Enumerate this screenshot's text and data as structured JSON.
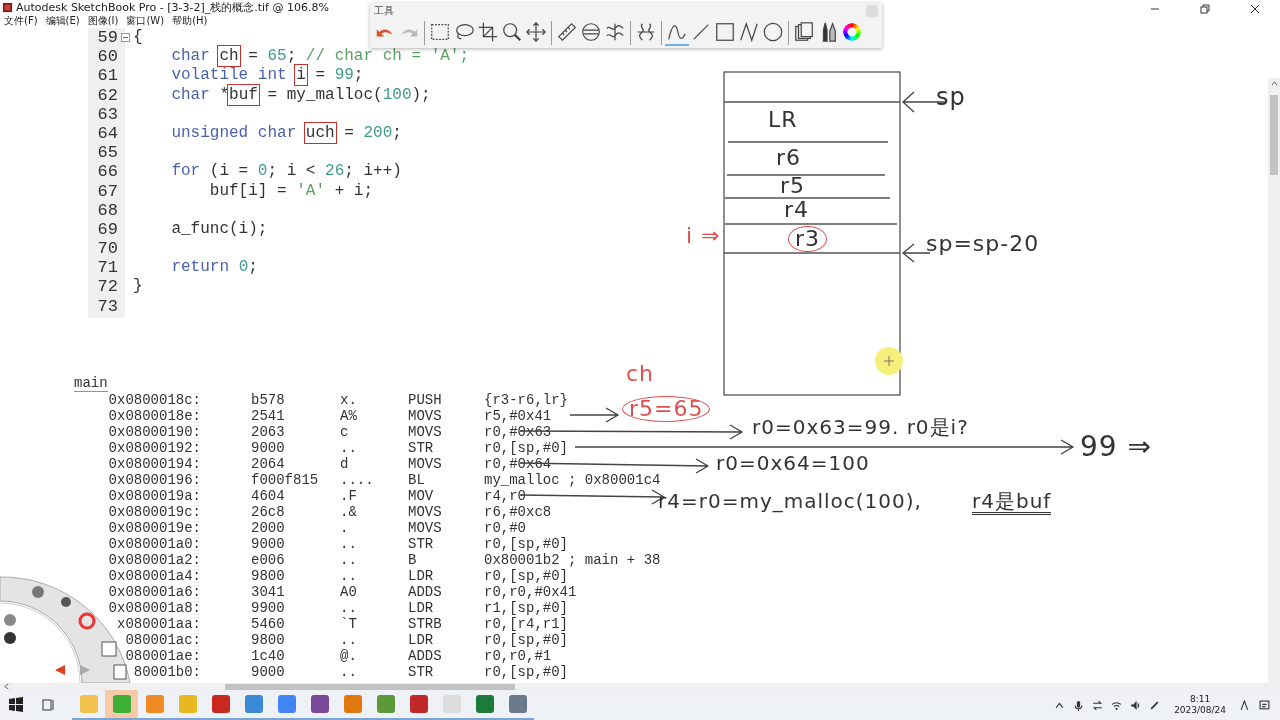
{
  "window": {
    "title": "Autodesk SketchBook Pro - [3-3-2]_栈的概念.tif @ 106.8%",
    "menu": [
      "文件(F)",
      "编辑(E)",
      "图像(I)",
      "窗口(W)",
      "帮助(H)"
    ]
  },
  "toolbar": {
    "title": "工具",
    "groups": [
      [
        {
          "kind": "undo",
          "selected": false
        },
        {
          "kind": "redo",
          "selected": false
        }
      ],
      [
        {
          "kind": "select",
          "selected": false
        },
        {
          "kind": "lasso",
          "selected": false
        },
        {
          "kind": "crop",
          "selected": false
        },
        {
          "kind": "zoom",
          "selected": false
        },
        {
          "kind": "move",
          "selected": false
        }
      ],
      [
        {
          "kind": "ruler",
          "selected": false
        },
        {
          "kind": "ellipse",
          "selected": false
        },
        {
          "kind": "symmetry",
          "selected": false
        }
      ],
      [
        {
          "kind": "symmetry2",
          "selected": false
        }
      ],
      [
        {
          "kind": "stroke",
          "selected": true
        },
        {
          "kind": "line",
          "selected": false
        },
        {
          "kind": "rect",
          "selected": false
        },
        {
          "kind": "polyline",
          "selected": false
        },
        {
          "kind": "circle",
          "selected": false
        }
      ],
      [
        {
          "kind": "layers",
          "selected": false
        },
        {
          "kind": "brushes",
          "selected": false
        },
        {
          "kind": "color",
          "selected": false
        }
      ]
    ]
  },
  "code": {
    "lines": [
      {
        "number": "59",
        "fold": true,
        "tokens": [
          {
            "text": "{",
            "kind": "plain"
          }
        ]
      },
      {
        "number": "60",
        "fold": false,
        "tokens": [
          {
            "text": "    char ",
            "kind": "kw"
          },
          {
            "text": "ch",
            "kind": "boxed"
          },
          {
            "text": " = ",
            "kind": "plain"
          },
          {
            "text": "65",
            "kind": "num"
          },
          {
            "text": "; ",
            "kind": "plain"
          },
          {
            "text": "// char ch = 'A';",
            "kind": "cmt"
          }
        ]
      },
      {
        "number": "61",
        "fold": false,
        "tokens": [
          {
            "text": "    volatile int ",
            "kind": "kw"
          },
          {
            "text": "i",
            "kind": "boxed"
          },
          {
            "text": " = ",
            "kind": "plain"
          },
          {
            "text": "99",
            "kind": "num"
          },
          {
            "text": ";",
            "kind": "plain"
          }
        ]
      },
      {
        "number": "62",
        "fold": false,
        "tokens": [
          {
            "text": "    char ",
            "kind": "kw"
          },
          {
            "text": "*",
            "kind": "plain"
          },
          {
            "text": "buf",
            "kind": "boxed"
          },
          {
            "text": " = my_malloc(",
            "kind": "plain"
          },
          {
            "text": "100",
            "kind": "num"
          },
          {
            "text": ");",
            "kind": "plain"
          }
        ]
      },
      {
        "number": "63",
        "fold": false
      },
      {
        "number": "64",
        "fold": false,
        "tokens": [
          {
            "text": "    unsigned char ",
            "kind": "kw"
          },
          {
            "text": "uch",
            "kind": "boxed"
          },
          {
            "text": " = ",
            "kind": "plain"
          },
          {
            "text": "200",
            "kind": "num"
          },
          {
            "text": ";",
            "kind": "plain"
          }
        ]
      },
      {
        "number": "65",
        "fold": false
      },
      {
        "number": "66",
        "fold": false,
        "tokens": [
          {
            "text": "    for ",
            "kind": "kw"
          },
          {
            "text": "(i = ",
            "kind": "plain"
          },
          {
            "text": "0",
            "kind": "num"
          },
          {
            "text": "; i < ",
            "kind": "plain"
          },
          {
            "text": "26",
            "kind": "num"
          },
          {
            "text": "; i++)",
            "kind": "plain"
          }
        ]
      },
      {
        "number": "67",
        "fold": false,
        "tokens": [
          {
            "text": "        buf[i] = ",
            "kind": "plain"
          },
          {
            "text": "'A'",
            "kind": "str"
          },
          {
            "text": " + i;",
            "kind": "plain"
          }
        ]
      },
      {
        "number": "68",
        "fold": false
      },
      {
        "number": "69",
        "fold": false,
        "tokens": [
          {
            "text": "    a_func(i);",
            "kind": "plain"
          }
        ]
      },
      {
        "number": "70",
        "fold": false
      },
      {
        "number": "71",
        "fold": false,
        "tokens": [
          {
            "text": "    return ",
            "kind": "kw"
          },
          {
            "text": "0",
            "kind": "num"
          },
          {
            "text": ";",
            "kind": "plain"
          }
        ]
      },
      {
        "number": "72",
        "fold": false,
        "tokens": [
          {
            "text": "}",
            "kind": "plain"
          }
        ]
      },
      {
        "number": "73",
        "fold": false
      }
    ]
  },
  "disassembly": {
    "label": "main",
    "rows": [
      {
        "address": "0x0800018c:",
        "hex": "b578",
        "ascii": "x.",
        "mnemonic": "PUSH",
        "operands": "{r3-r6,lr}"
      },
      {
        "address": "0x0800018e:",
        "hex": "2541",
        "ascii": "A%",
        "mnemonic": "MOVS",
        "operands": "r5,#0x41"
      },
      {
        "address": "0x08000190:",
        "hex": "2063",
        "ascii": "c",
        "mnemonic": "MOVS",
        "operands": "r0,#0x63"
      },
      {
        "address": "0x08000192:",
        "hex": "9000",
        "ascii": "..",
        "mnemonic": "STR",
        "operands": "r0,[sp,#0]"
      },
      {
        "address": "0x08000194:",
        "hex": "2064",
        "ascii": "d",
        "mnemonic": "MOVS",
        "operands": "r0,#0x64"
      },
      {
        "address": "0x08000196:",
        "hex": "f000f815",
        "ascii": "....",
        "mnemonic": "BL",
        "operands": "my_malloc ; 0x80001c4"
      },
      {
        "address": "0x0800019a:",
        "hex": "4604",
        "ascii": ".F",
        "mnemonic": "MOV",
        "operands": "r4,r0"
      },
      {
        "address": "0x0800019c:",
        "hex": "26c8",
        "ascii": ".&",
        "mnemonic": "MOVS",
        "operands": "r6,#0xc8"
      },
      {
        "address": "0x0800019e:",
        "hex": "2000",
        "ascii": ".",
        "mnemonic": "MOVS",
        "operands": "r0,#0"
      },
      {
        "address": "0x080001a0:",
        "hex": "9000",
        "ascii": "..",
        "mnemonic": "STR",
        "operands": "r0,[sp,#0]"
      },
      {
        "address": "0x080001a2:",
        "hex": "e006",
        "ascii": "..",
        "mnemonic": "B",
        "operands": "0x80001b2 ; main + 38"
      },
      {
        "address": "0x080001a4:",
        "hex": "9800",
        "ascii": "..",
        "mnemonic": "LDR",
        "operands": "r0,[sp,#0]"
      },
      {
        "address": "0x080001a6:",
        "hex": "3041",
        "ascii": "A0",
        "mnemonic": "ADDS",
        "operands": "r0,r0,#0x41"
      },
      {
        "address": "0x080001a8:",
        "hex": "9900",
        "ascii": "..",
        "mnemonic": "LDR",
        "operands": "r1,[sp,#0]"
      },
      {
        "address": "x080001aa:",
        "hex": "5460",
        "ascii": "`T",
        "mnemonic": "STRB",
        "operands": "r0,[r4,r1]"
      },
      {
        "address": "080001ac:",
        "hex": "9800",
        "ascii": "..",
        "mnemonic": "LDR",
        "operands": "r0,[sp,#0]"
      },
      {
        "address": "080001ae:",
        "hex": "1c40",
        "ascii": "@.",
        "mnemonic": "ADDS",
        "operands": "r0,r0,#1"
      },
      {
        "address": "80001b0:",
        "hex": "9000",
        "ascii": "..",
        "mnemonic": "STR",
        "operands": "r0,[sp,#0]"
      }
    ]
  },
  "stack": {
    "slots": [
      {
        "label": "LR",
        "circled": false
      },
      {
        "label": "r6",
        "circled": false
      },
      {
        "label": "r5",
        "circled": false
      },
      {
        "label": "r4",
        "circled": false
      },
      {
        "label": "r3",
        "circled": true
      }
    ]
  },
  "notes": [
    {
      "text": "sp",
      "color": "#333333",
      "circled": false,
      "underlined": false
    },
    {
      "text": "sp=sp-20",
      "color": "#333333",
      "circled": false,
      "underlined": false
    },
    {
      "text": "i ⇒",
      "color": "#e05050",
      "circled": false,
      "underlined": false
    },
    {
      "text": "ch",
      "color": "#e05050",
      "circled": false,
      "underlined": false
    },
    {
      "text": "r5=65",
      "color": "#e05050",
      "circled": true,
      "underlined": false
    },
    {
      "text": "r0=0x63=99. r0是i?",
      "color": "#333333",
      "circled": false,
      "underlined": false
    },
    {
      "text": "99 ⇒",
      "color": "#333333",
      "circled": false,
      "underlined": false
    },
    {
      "text": "r0=0x64=100",
      "color": "#333333",
      "circled": false,
      "underlined": false
    },
    {
      "text": "r4=r0=my_malloc(100),",
      "color": "#333333",
      "circled": false,
      "underlined": false
    },
    {
      "text": "r4是buf",
      "color": "#333333",
      "circled": false,
      "underlined": true
    }
  ],
  "taskbar": {
    "apps": [
      {
        "color": "#f2c14e",
        "selected": false
      },
      {
        "color": "#3cb034",
        "selected": true
      },
      {
        "color": "#f08a24",
        "selected": false
      },
      {
        "color": "#e8b820",
        "selected": false
      },
      {
        "color": "#c8281e",
        "selected": false
      },
      {
        "color": "#3a8ad8",
        "selected": false
      },
      {
        "color": "#4285f4",
        "selected": false
      },
      {
        "color": "#7a4a9a",
        "selected": false
      },
      {
        "color": "#e07a10",
        "selected": false
      },
      {
        "color": "#5a9a3a",
        "selected": false
      },
      {
        "color": "#c02828",
        "selected": false
      },
      {
        "color": "#dddddd",
        "selected": false
      },
      {
        "color": "#1e7a3a",
        "selected": false
      },
      {
        "color": "#6a7a8a",
        "selected": false
      }
    ],
    "time": "8:11",
    "date": "2023/08/24"
  }
}
